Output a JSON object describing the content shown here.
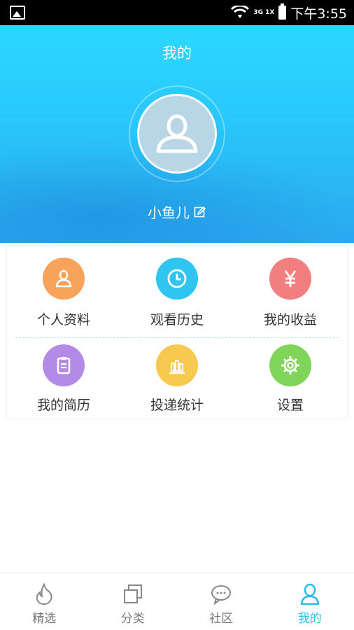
{
  "status_bar": {
    "network": "3G 1X",
    "time": "下午3:55"
  },
  "header": {
    "title": "我的",
    "username": "小鱼儿"
  },
  "menu": {
    "row1": [
      {
        "label": "个人资料",
        "icon": "person-icon",
        "color": "#f7a35c"
      },
      {
        "label": "观看历史",
        "icon": "clock-icon",
        "color": "#2fc5f0"
      },
      {
        "label": "我的收益",
        "icon": "yen-icon",
        "color": "#f27f7f"
      }
    ],
    "row2": [
      {
        "label": "我的简历",
        "icon": "clipboard-icon",
        "color": "#b48ae8"
      },
      {
        "label": "投递统计",
        "icon": "bar-chart-icon",
        "color": "#f8c94f"
      },
      {
        "label": "设置",
        "icon": "gear-icon",
        "color": "#7fd45a"
      }
    ]
  },
  "tabbar": {
    "tabs": [
      {
        "label": "精选",
        "icon": "flame-icon"
      },
      {
        "label": "分类",
        "icon": "squares-icon"
      },
      {
        "label": "社区",
        "icon": "chat-icon"
      },
      {
        "label": "我的",
        "icon": "person-icon",
        "active": true
      }
    ],
    "active_color": "#2bbcea",
    "inactive_color": "#777777"
  }
}
